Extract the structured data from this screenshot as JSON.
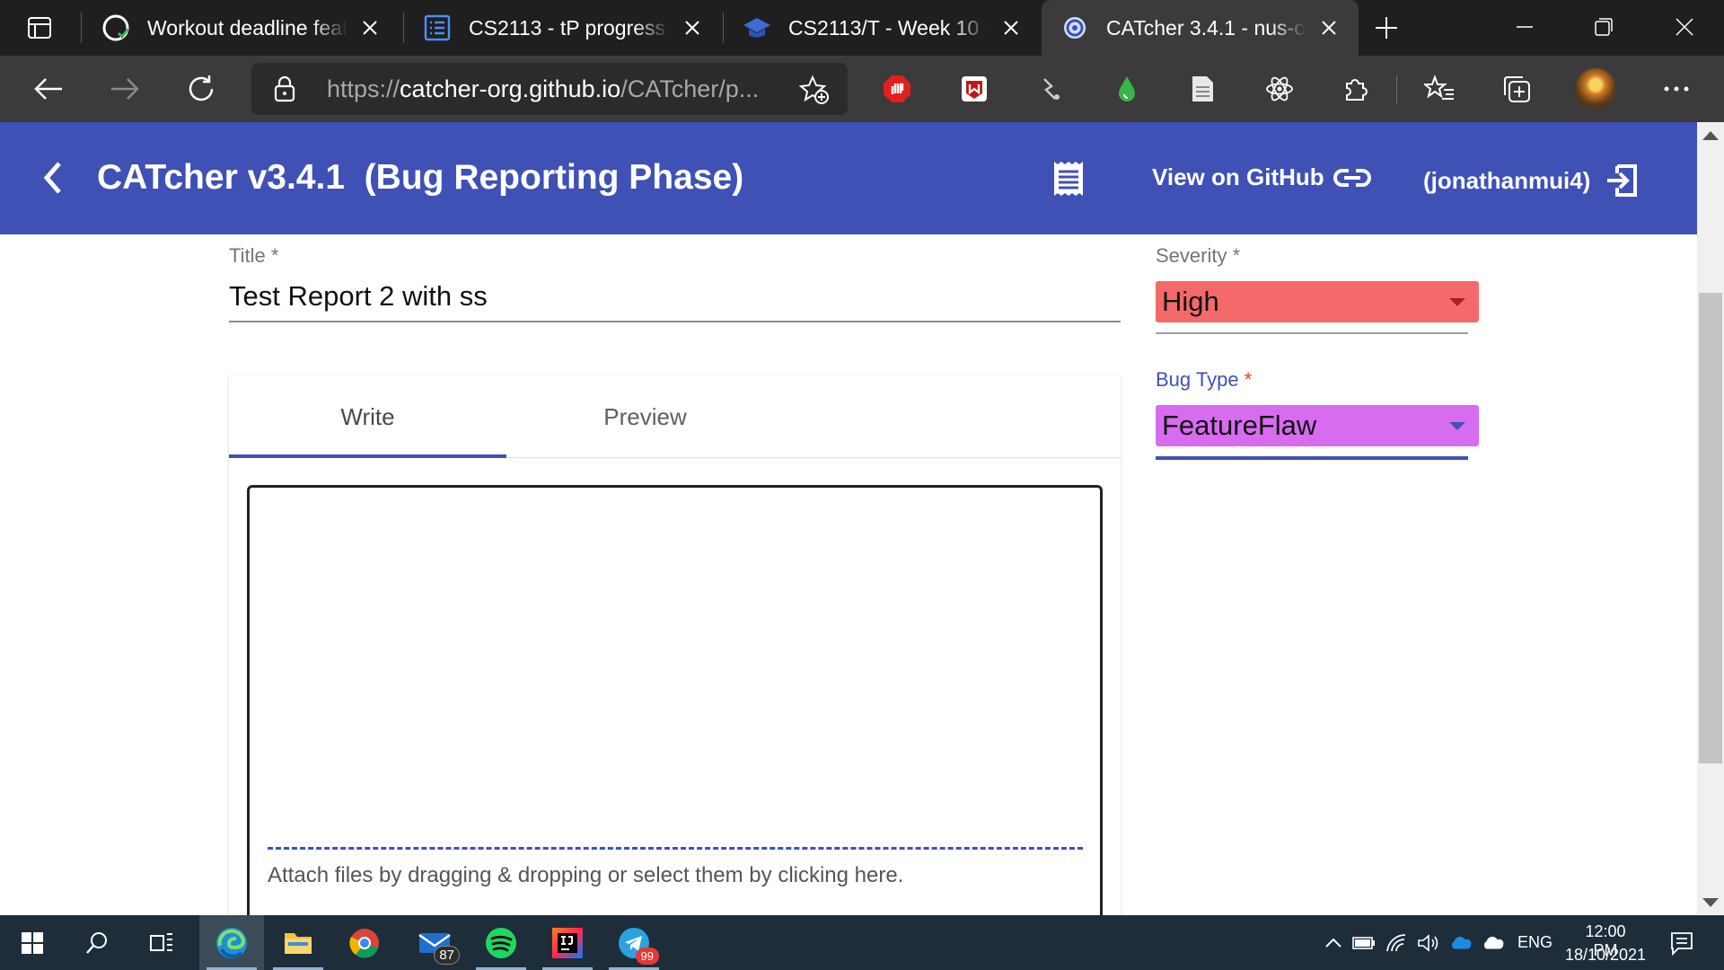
{
  "browser": {
    "tabs": [
      {
        "title": "Workout deadline feat"
      },
      {
        "title": "CS2113 - tP progress d"
      },
      {
        "title": "CS2113/T - Week 10 -"
      },
      {
        "title": "CATcher 3.4.1 - nus-cs"
      }
    ],
    "url": {
      "protocol": "https://",
      "host": "catcher-org.github.io",
      "path": "/CATcher/p..."
    }
  },
  "app": {
    "title": "CATcher v3.4.1  (Bug Reporting Phase)",
    "view_on_github": "View on GitHub",
    "user": "(jonathanmui4)"
  },
  "form": {
    "title_label": "Title",
    "title_value": "Test Report 2 with ss",
    "severity_label": "Severity",
    "severity_value": "High",
    "severity_color": "#f46a6a",
    "bugtype_label": "Bug Type",
    "bugtype_value": "FeatureFlaw",
    "bugtype_color": "#d86cf0",
    "required_mark": "*",
    "tabs": [
      "Write",
      "Preview"
    ],
    "attach_hint": "Attach files by dragging & dropping or select them by clicking here."
  },
  "taskbar": {
    "mail_badge": "87",
    "telegram_badge": "99",
    "language": "ENG",
    "time": "12:00 PM",
    "date": "18/10/2021"
  },
  "colors": {
    "primary": "#3f51b5",
    "tabstrip_bg": "#1f1f1f",
    "toolbar_bg": "#3b3b3b",
    "taskbar_bg": "#1e2d3a"
  }
}
